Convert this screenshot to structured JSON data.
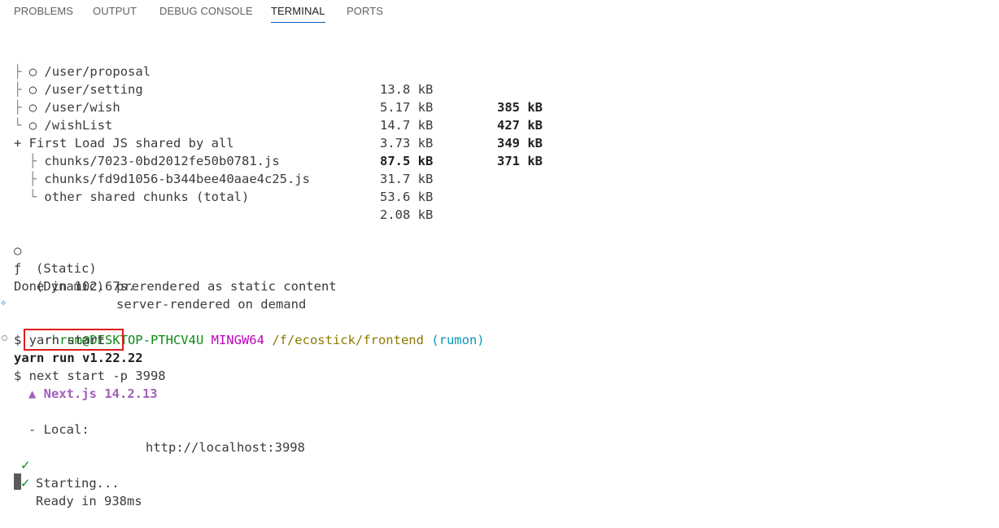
{
  "panel_tabs": [
    "PROBLEMS",
    "OUTPUT",
    "DEBUG CONSOLE",
    "TERMINAL",
    "PORTS"
  ],
  "active_tab": "TERMINAL",
  "routes": [
    {
      "tree": "├",
      "icon": "○",
      "path": "/user/proposal",
      "size": "13.8 kB",
      "first_load": "385 kB"
    },
    {
      "tree": "├",
      "icon": "○",
      "path": "/user/setting",
      "size": "5.17 kB",
      "first_load": "427 kB"
    },
    {
      "tree": "├",
      "icon": "○",
      "path": "/user/wish",
      "size": "14.7 kB",
      "first_load": "349 kB"
    },
    {
      "tree": "└",
      "icon": "○",
      "path": "/wishList",
      "size": "3.73 kB",
      "first_load": "371 kB"
    }
  ],
  "shared": {
    "label": "+ First Load JS shared by all",
    "size": "87.5 kB",
    "chunks": [
      {
        "tree": "├",
        "name": "chunks/7023-0bd2012fe50b0781.js",
        "size": "31.7 kB"
      },
      {
        "tree": "├",
        "name": "chunks/fd9d1056-b344bee40aae4c25.js",
        "size": "53.6 kB"
      },
      {
        "tree": "└",
        "name": "other shared chunks (total)",
        "size": "2.08 kB"
      }
    ]
  },
  "legend": [
    {
      "symbol": "○",
      "kind": "(Static)",
      "desc": "prerendered as static content"
    },
    {
      "symbol": "ƒ",
      "kind": "(Dynamic)",
      "desc": "server-rendered on demand"
    }
  ],
  "done": "Done in 102.67s.",
  "prompt": {
    "user_host": "rhrum@DESKTOP-PTHCV4U",
    "env": "MINGW64",
    "path": "/f/ecostick/frontend",
    "branch": "(rumon)"
  },
  "command": "$ yarn start",
  "output": {
    "yarn_version": "yarn run v1.22.22",
    "next_cmd": "$ next start -p 3998",
    "next_version": "▲ Next.js 14.2.13",
    "local_label": "- Local:",
    "local_url": "http://localhost:3998",
    "starting": "Starting...",
    "ready": "Ready in 938ms",
    "check": "✓"
  }
}
